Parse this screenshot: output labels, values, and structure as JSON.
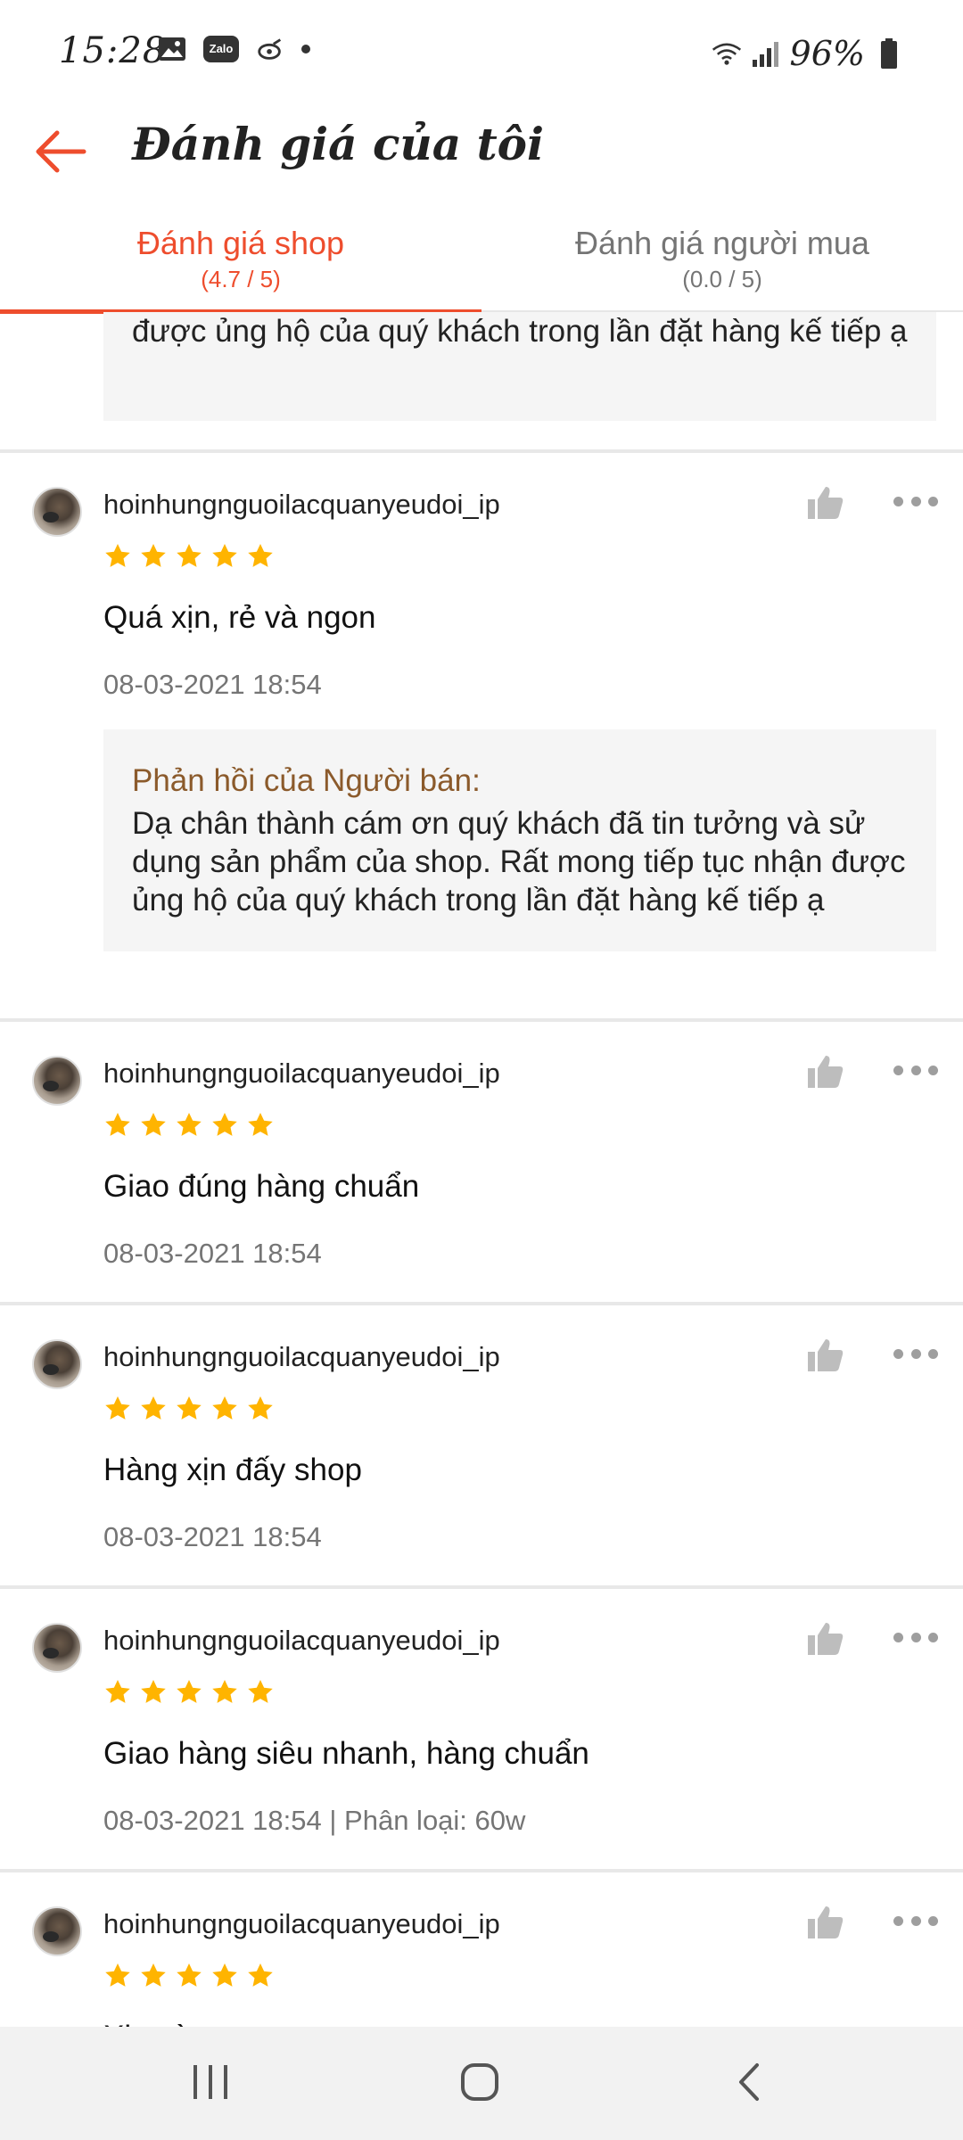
{
  "status_bar": {
    "time": "15:28",
    "zalo_label": "Zalo",
    "battery": "96%",
    "icons": [
      "gallery-icon",
      "zalo-icon",
      "bug-icon",
      "dot-icon",
      "wifi-icon",
      "signal-icon",
      "battery-icon"
    ]
  },
  "header": {
    "title": "Đánh giá của tôi",
    "back_icon": "back-arrow-icon"
  },
  "tabs": [
    {
      "label": "Đánh giá shop",
      "score": "(4.7 / 5)",
      "active": true
    },
    {
      "label": "Đánh giá người mua",
      "score": "(0.0 / 5)",
      "active": false
    }
  ],
  "partial_reply": {
    "text": "được ủng hộ của quý khách trong lần đặt hàng kế tiếp ạ"
  },
  "reviews": [
    {
      "username": "hoinhungnguoilacquanyeudoi_ip",
      "rating": 5,
      "comment": "Quá xịn, rẻ và ngon",
      "meta": "08-03-2021 18:54",
      "reply": {
        "title": "Phản hồi của Người bán:",
        "text": "Dạ chân thành cám ơn quý khách đã tin tưởng và sử dụng sản phẩm của shop. Rất mong tiếp tục nhận được ủng hộ của quý khách trong lần đặt hàng kế tiếp ạ"
      }
    },
    {
      "username": "hoinhungnguoilacquanyeudoi_ip",
      "rating": 5,
      "comment": "Giao đúng hàng chuẩn",
      "meta": "08-03-2021 18:54"
    },
    {
      "username": "hoinhungnguoilacquanyeudoi_ip",
      "rating": 5,
      "comment": "Hàng xịn đấy shop",
      "meta": "08-03-2021 18:54"
    },
    {
      "username": "hoinhungnguoilacquanyeudoi_ip",
      "rating": 5,
      "comment": "Giao hàng siêu nhanh, hàng chuẩn",
      "meta": "08-03-2021 18:54 | Phân loại: 60w"
    },
    {
      "username": "hoinhungnguoilacquanyeudoi_ip",
      "rating": 5,
      "comment": "Xin xò",
      "meta": ""
    }
  ],
  "colors": {
    "accent": "#ee4d2d",
    "star": "#ffb400",
    "reply_title": "#8b5a2b",
    "muted": "#757575"
  },
  "nav_bar": {
    "icons": [
      "recent-apps-icon",
      "home-icon",
      "back-nav-icon"
    ]
  }
}
